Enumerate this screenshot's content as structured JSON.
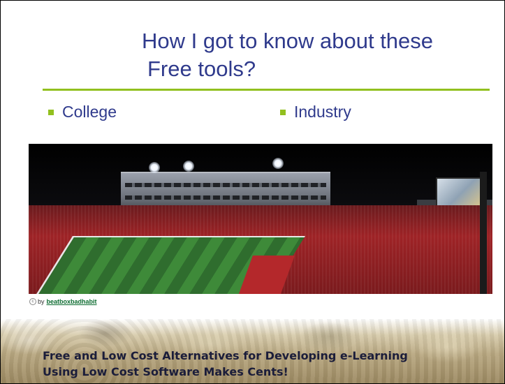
{
  "slide": {
    "title_line1": "How I got to know about these",
    "title_line2": "Free tools?",
    "bullets": [
      {
        "label": "College"
      },
      {
        "label": "Industry"
      }
    ],
    "photo_credit": {
      "prefix": "by",
      "author": "beatboxbadhabit"
    },
    "footer": {
      "line1": "Free and Low Cost Alternatives for Developing e-Learning",
      "line2": "Using Low Cost Software Makes Cents!"
    },
    "colors": {
      "title": "#2f3a8c",
      "accent": "#92c01f"
    }
  }
}
